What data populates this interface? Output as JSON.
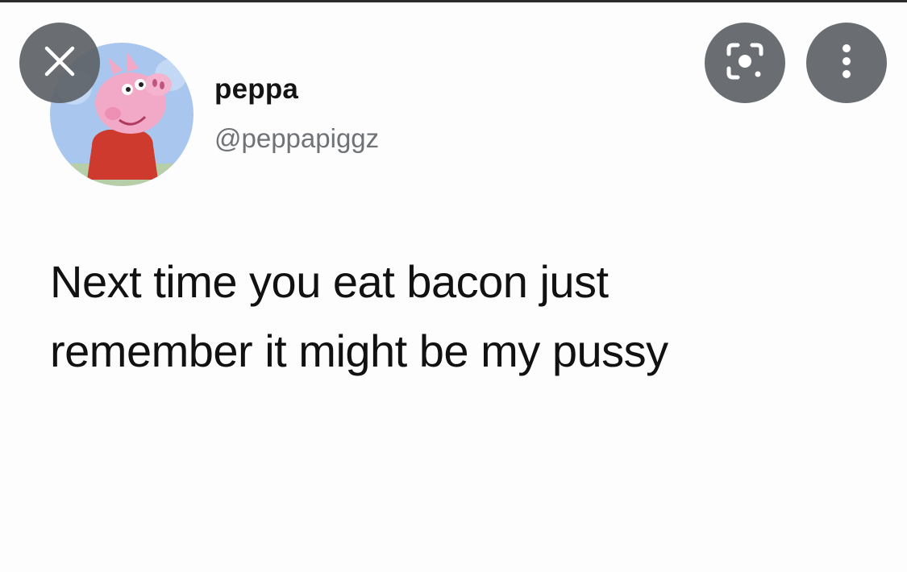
{
  "viewer": {
    "close_icon": "close-icon",
    "lens_icon": "lens-icon",
    "more_icon": "more-vert-icon"
  },
  "tweet": {
    "display_name": "peppa",
    "handle": "@peppapiggz",
    "text_lines": [
      "Next time you eat bacon just",
      "remember it might be my pussy"
    ]
  },
  "colors": {
    "overlay_button": "#5f6368",
    "text": "#111111",
    "handle": "#6f7377"
  }
}
